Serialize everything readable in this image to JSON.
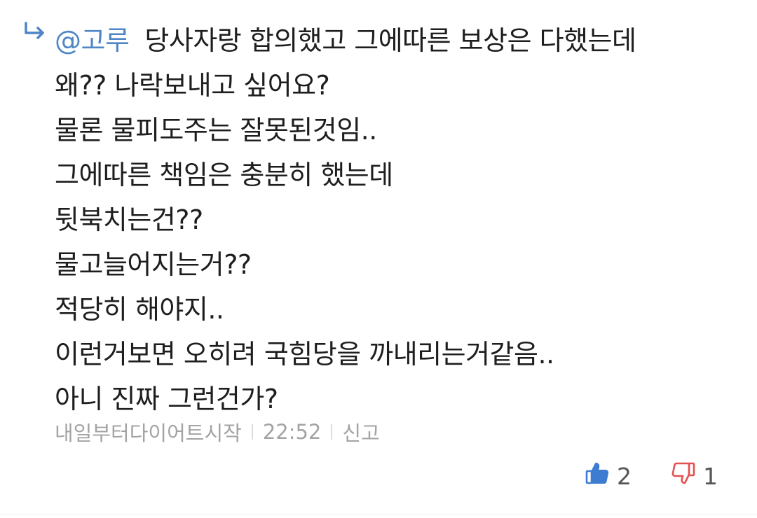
{
  "comment": {
    "reply_icon": "reply-arrow-icon",
    "mention": "@고루",
    "first_line_text": "당사자랑 합의했고 그에따른 보상은 다했는데",
    "lines": [
      "왜?? 나락보내고 싶어요?",
      "물론 물피도주는 잘못된것임..",
      "그에따른 책임은 충분히 했는데",
      "뒷북치는건??",
      "물고늘어지는거??",
      "적당히 해야지..",
      "이런거보면 오히려 국힘당을 까내리는거같음..",
      "아니 진짜 그런건가?"
    ]
  },
  "meta": {
    "author": "내일부터다이어트시작",
    "time": "22:52",
    "report_label": "신고"
  },
  "votes": {
    "like_icon": "thumbs-up-icon",
    "like_count": "2",
    "dislike_icon": "thumbs-down-icon",
    "dislike_count": "1"
  },
  "colors": {
    "mention": "#4f86c6",
    "reply_arrow": "#4f86c6",
    "like_icon": "#3d7cd0",
    "dislike_icon": "#e25151",
    "meta_text": "#a3a3a3",
    "body_text": "#1e1e1e"
  }
}
